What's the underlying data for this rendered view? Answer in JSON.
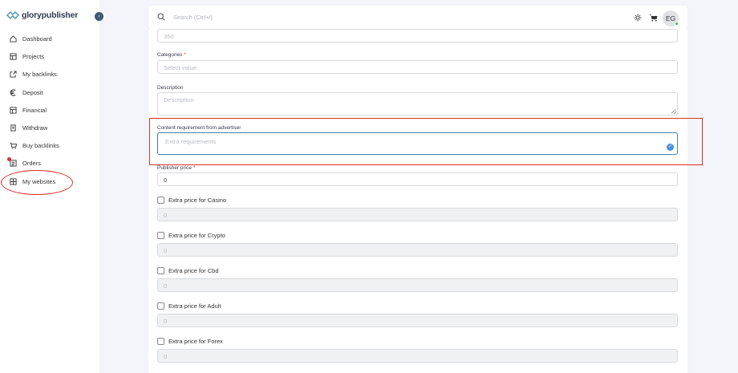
{
  "brand": {
    "name_a": "glory",
    "name_b": "publisher"
  },
  "sidebar": {
    "collapse_icon": "chevron-left-icon",
    "items": [
      {
        "label": "Dashboard",
        "icon": "home-icon"
      },
      {
        "label": "Projects",
        "icon": "layout-icon"
      },
      {
        "label": "My backlinks",
        "icon": "external-link-icon"
      },
      {
        "label": "Deposit",
        "icon": "euro-icon"
      },
      {
        "label": "Financial",
        "icon": "layout-icon"
      },
      {
        "label": "Withdraw",
        "icon": "receipt-icon"
      },
      {
        "label": "Buy backlinks",
        "icon": "cart-icon"
      },
      {
        "label": "Orders",
        "icon": "list-icon"
      },
      {
        "label": "My websites",
        "icon": "grid-icon"
      }
    ]
  },
  "header": {
    "search_placeholder": "Search (Ctrl+/)",
    "avatar_initials": "EG"
  },
  "form": {
    "top_value": "350",
    "categories": {
      "label": "Categories",
      "required": "*",
      "placeholder": "Select value"
    },
    "description": {
      "label": "Description",
      "placeholder": "Description"
    },
    "content_requirement": {
      "label": "Content requirement from advertiser",
      "placeholder": "Extra requirements"
    },
    "publisher_price": {
      "label": "Publisher price",
      "required": "*",
      "value": "0"
    },
    "extras": [
      {
        "label": "Extra price for Casino",
        "value": "0"
      },
      {
        "label": "Extra price for Crypto",
        "value": "0"
      },
      {
        "label": "Extra price for Cbd",
        "value": "0"
      },
      {
        "label": "Extra price for Adult",
        "value": "0"
      },
      {
        "label": "Extra price for Forex",
        "value": "0"
      }
    ]
  },
  "colors": {
    "accent": "#3d5a73",
    "highlight": "#d9302a",
    "focus": "#4a7fa6"
  }
}
